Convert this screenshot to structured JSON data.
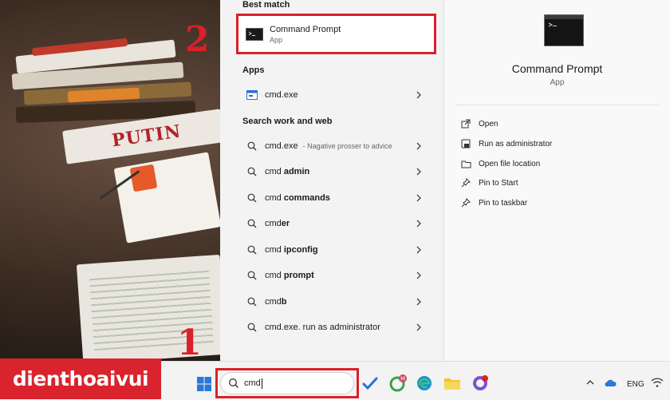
{
  "background": {
    "book_title": "PUTIN"
  },
  "annotations": {
    "step1": "1",
    "step2": "2",
    "highlight_color": "#d8212a"
  },
  "results": {
    "best_match_heading": "Best match",
    "best_match": {
      "name": "Command Prompt",
      "kind": "App"
    },
    "apps_heading": "Apps",
    "apps": [
      {
        "name": "cmd.exe"
      }
    ],
    "web_heading": "Search work and web",
    "web": [
      {
        "prefix": "cmd.exe",
        "bold": "",
        "suffix": " - Nagative prosser to advice"
      },
      {
        "prefix": "cmd ",
        "bold": "admin",
        "suffix": ""
      },
      {
        "prefix": "cmd ",
        "bold": "commands",
        "suffix": ""
      },
      {
        "prefix": "cmd",
        "bold": "er",
        "suffix": ""
      },
      {
        "prefix": "cmd ",
        "bold": "ipconfig",
        "suffix": ""
      },
      {
        "prefix": "cmd ",
        "bold": "prompt",
        "suffix": ""
      },
      {
        "prefix": "cmd",
        "bold": "b",
        "suffix": ""
      },
      {
        "prefix": "cmd.exe. run as administrator",
        "bold": "",
        "suffix": ""
      }
    ]
  },
  "details": {
    "title": "Command Prompt",
    "kind": "App",
    "actions": [
      {
        "label": "Open",
        "icon": "open-icon"
      },
      {
        "label": "Run as administrator",
        "icon": "shield-icon"
      },
      {
        "label": "Open file location",
        "icon": "folder-icon"
      },
      {
        "label": "Pin to Start",
        "icon": "pin-icon"
      },
      {
        "label": "Pin to taskbar",
        "icon": "pin-icon"
      }
    ]
  },
  "branding": {
    "text": "dienthoaivui",
    "color": "#d9232d"
  },
  "taskbar": {
    "search_value": "cmd",
    "badge": "M",
    "language": "ENG"
  }
}
